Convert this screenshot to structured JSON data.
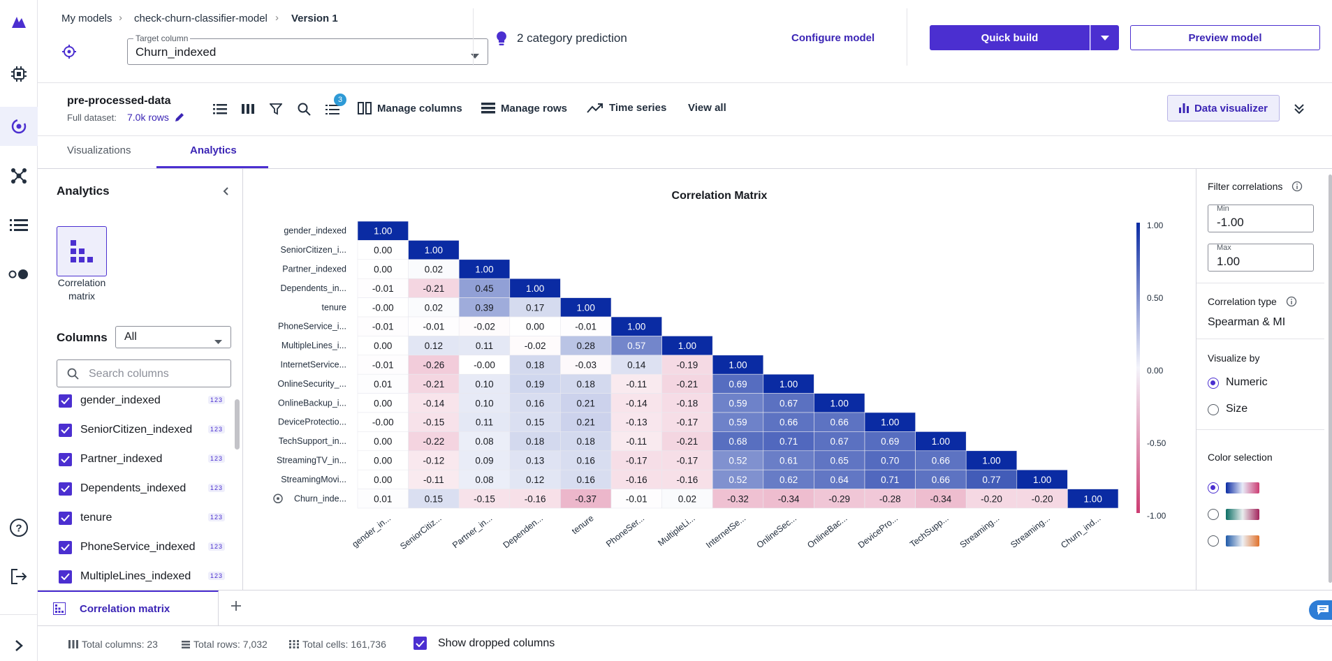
{
  "breadcrumb": {
    "items": [
      "My models",
      "check-churn-classifier-model",
      "Version 1"
    ]
  },
  "target": {
    "label": "Target column",
    "value": "Churn_indexed"
  },
  "prediction": {
    "text": "2 category prediction",
    "configure": "Configure model"
  },
  "actions": {
    "quick_build": "Quick build",
    "preview": "Preview model"
  },
  "dataset": {
    "name": "pre-processed-data",
    "full_label": "Full dataset:",
    "rows": "7.0k rows",
    "badge": "3"
  },
  "toolbar": {
    "manage_columns": "Manage columns",
    "manage_rows": "Manage rows",
    "time_series": "Time series",
    "view_all": "View all",
    "data_visualizer": "Data visualizer"
  },
  "tabs": [
    "Visualizations",
    "Analytics"
  ],
  "left": {
    "title": "Analytics",
    "card_label_1": "Correlation",
    "card_label_2": "matrix",
    "columns_label": "Columns",
    "columns_filter": "All",
    "search_placeholder": "Search columns",
    "column_items": [
      "gender_indexed",
      "SeniorCitizen_indexed",
      "Partner_indexed",
      "Dependents_indexed",
      "tenure",
      "PhoneService_indexed",
      "MultipleLines_indexed"
    ],
    "type_badge": "123"
  },
  "right": {
    "filter_label": "Filter correlations",
    "min_label": "Min",
    "min_value": "-1.00",
    "max_label": "Max",
    "max_value": "1.00",
    "corr_type_label": "Correlation type",
    "corr_type_value": "Spearman & MI",
    "visualize_label": "Visualize by",
    "options": [
      "Numeric",
      "Size"
    ],
    "color_label": "Color selection"
  },
  "bottom_tab": "Correlation matrix",
  "status": {
    "columns": "Total columns: 23",
    "rows": "Total rows: 7,032",
    "cells": "Total cells: 161,736",
    "show_dropped": "Show dropped columns"
  },
  "colors": {
    "accent": "#4b2fd0",
    "pos": "#0a2ba3",
    "neg": "#cc3c72"
  },
  "chart_data": {
    "type": "heatmap",
    "title": "Correlation Matrix",
    "row_labels": [
      "gender_indexed",
      "SeniorCitizen_i...",
      "Partner_indexed",
      "Dependents_in...",
      "tenure",
      "PhoneService_i...",
      "MultipleLines_i...",
      "InternetService...",
      "OnlineSecurity_...",
      "OnlineBackup_i...",
      "DeviceProtectio...",
      "TechSupport_in...",
      "StreamingTV_in...",
      "StreamingMovi...",
      "Churn_inde..."
    ],
    "col_labels": [
      "gender_in...",
      "SeniorCitiz...",
      "Partner_in...",
      "Dependen...",
      "tenure",
      "PhoneSer...",
      "MultipleLi...",
      "InternetSe...",
      "OnlineSec...",
      "OnlineBac...",
      "DevicePro...",
      "TechSupp...",
      "Streaming...",
      "Streaming...",
      "Churn_ind..."
    ],
    "values": [
      [
        "1.00"
      ],
      [
        "0.00",
        "1.00"
      ],
      [
        "0.00",
        "0.02",
        "1.00"
      ],
      [
        "-0.01",
        "-0.21",
        "0.45",
        "1.00"
      ],
      [
        "-0.00",
        "0.02",
        "0.39",
        "0.17",
        "1.00"
      ],
      [
        "-0.01",
        "-0.01",
        "-0.02",
        "0.00",
        "-0.01",
        "1.00"
      ],
      [
        "0.00",
        "0.12",
        "0.11",
        "-0.02",
        "0.28",
        "0.57",
        "1.00"
      ],
      [
        "-0.01",
        "-0.26",
        "-0.00",
        "0.18",
        "-0.03",
        "0.14",
        "-0.19",
        "1.00"
      ],
      [
        "0.01",
        "-0.21",
        "0.10",
        "0.19",
        "0.18",
        "-0.11",
        "-0.21",
        "0.69",
        "1.00"
      ],
      [
        "0.00",
        "-0.14",
        "0.10",
        "0.16",
        "0.21",
        "-0.14",
        "-0.18",
        "0.59",
        "0.67",
        "1.00"
      ],
      [
        "-0.00",
        "-0.15",
        "0.11",
        "0.15",
        "0.21",
        "-0.13",
        "-0.17",
        "0.59",
        "0.66",
        "0.66",
        "1.00"
      ],
      [
        "0.00",
        "-0.22",
        "0.08",
        "0.18",
        "0.18",
        "-0.11",
        "-0.21",
        "0.68",
        "0.71",
        "0.67",
        "0.69",
        "1.00"
      ],
      [
        "0.00",
        "-0.12",
        "0.09",
        "0.13",
        "0.16",
        "-0.17",
        "-0.17",
        "0.52",
        "0.61",
        "0.65",
        "0.70",
        "0.66",
        "1.00"
      ],
      [
        "0.00",
        "-0.11",
        "0.08",
        "0.12",
        "0.16",
        "-0.16",
        "-0.16",
        "0.52",
        "0.62",
        "0.64",
        "0.71",
        "0.66",
        "0.77",
        "1.00"
      ],
      [
        "0.01",
        "0.15",
        "-0.15",
        "-0.16",
        "-0.37",
        "-0.01",
        "0.02",
        "-0.32",
        "-0.34",
        "-0.29",
        "-0.28",
        "-0.34",
        "-0.20",
        "-0.20",
        "1.00"
      ]
    ],
    "colorbar_ticks": [
      "1.00",
      "0.50",
      "0.00",
      "-0.50",
      "-1.00"
    ],
    "range": [
      -1,
      1
    ]
  }
}
